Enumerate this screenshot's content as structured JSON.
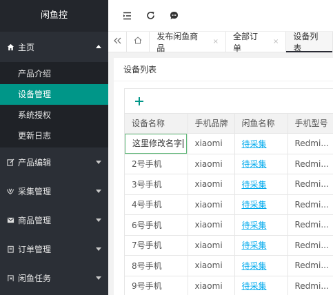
{
  "sidebar": {
    "logo": "闲鱼控",
    "home": {
      "label": "主页",
      "icon": "home-icon",
      "items": [
        "产品介绍",
        "设备管理",
        "系统授权",
        "更新日志"
      ]
    },
    "groups": [
      {
        "label": "产品编辑",
        "icon": "edit-icon"
      },
      {
        "label": "采集管理",
        "icon": "collect-icon"
      },
      {
        "label": "商品管理",
        "icon": "mail-icon"
      },
      {
        "label": "订单管理",
        "icon": "order-icon"
      },
      {
        "label": "闲鱼任务",
        "icon": "fish-icon"
      }
    ]
  },
  "header": {
    "icons": [
      "menu-fold-icon",
      "refresh-icon",
      "chat-icon"
    ]
  },
  "tabs": {
    "items": [
      {
        "label": "发布闲鱼商品",
        "closable": true
      },
      {
        "label": "全部订单",
        "closable": true
      },
      {
        "label": "设备列表",
        "closable": false
      }
    ],
    "close_glyph": "×"
  },
  "main": {
    "title": "设备列表",
    "table": {
      "columns": [
        "设备名称",
        "手机品牌",
        "闲鱼名称",
        "手机型号"
      ],
      "editing_value": "这里修改名字",
      "rows": [
        {
          "name": "这里修改名字",
          "brand": "xiaomi",
          "xianyu": "待采集",
          "model": "Redmi..."
        },
        {
          "name": "2号手机",
          "brand": "xiaomi",
          "xianyu": "待采集",
          "model": "Redmi..."
        },
        {
          "name": "3号手机",
          "brand": "xiaomi",
          "xianyu": "待采集",
          "model": "Redmi..."
        },
        {
          "name": "4号手机",
          "brand": "xiaomi",
          "xianyu": "待采集",
          "model": "Redmi..."
        },
        {
          "name": "6号手机",
          "brand": "xiaomi",
          "xianyu": "待采集",
          "model": "Redmi..."
        },
        {
          "name": "7号手机",
          "brand": "xiaomi",
          "xianyu": "待采集",
          "model": "Redmi..."
        },
        {
          "name": "8号手机",
          "brand": "xiaomi",
          "xianyu": "待采集",
          "model": "Redmi..."
        },
        {
          "name": "9号手机",
          "brand": "xiaomi",
          "xianyu": "待采集",
          "model": "Redmi..."
        }
      ]
    }
  },
  "colors": {
    "accent": "#009688",
    "sidebar_bg": "#2b2f36",
    "link": "#01aaed",
    "edit_border": "#5fb878"
  }
}
